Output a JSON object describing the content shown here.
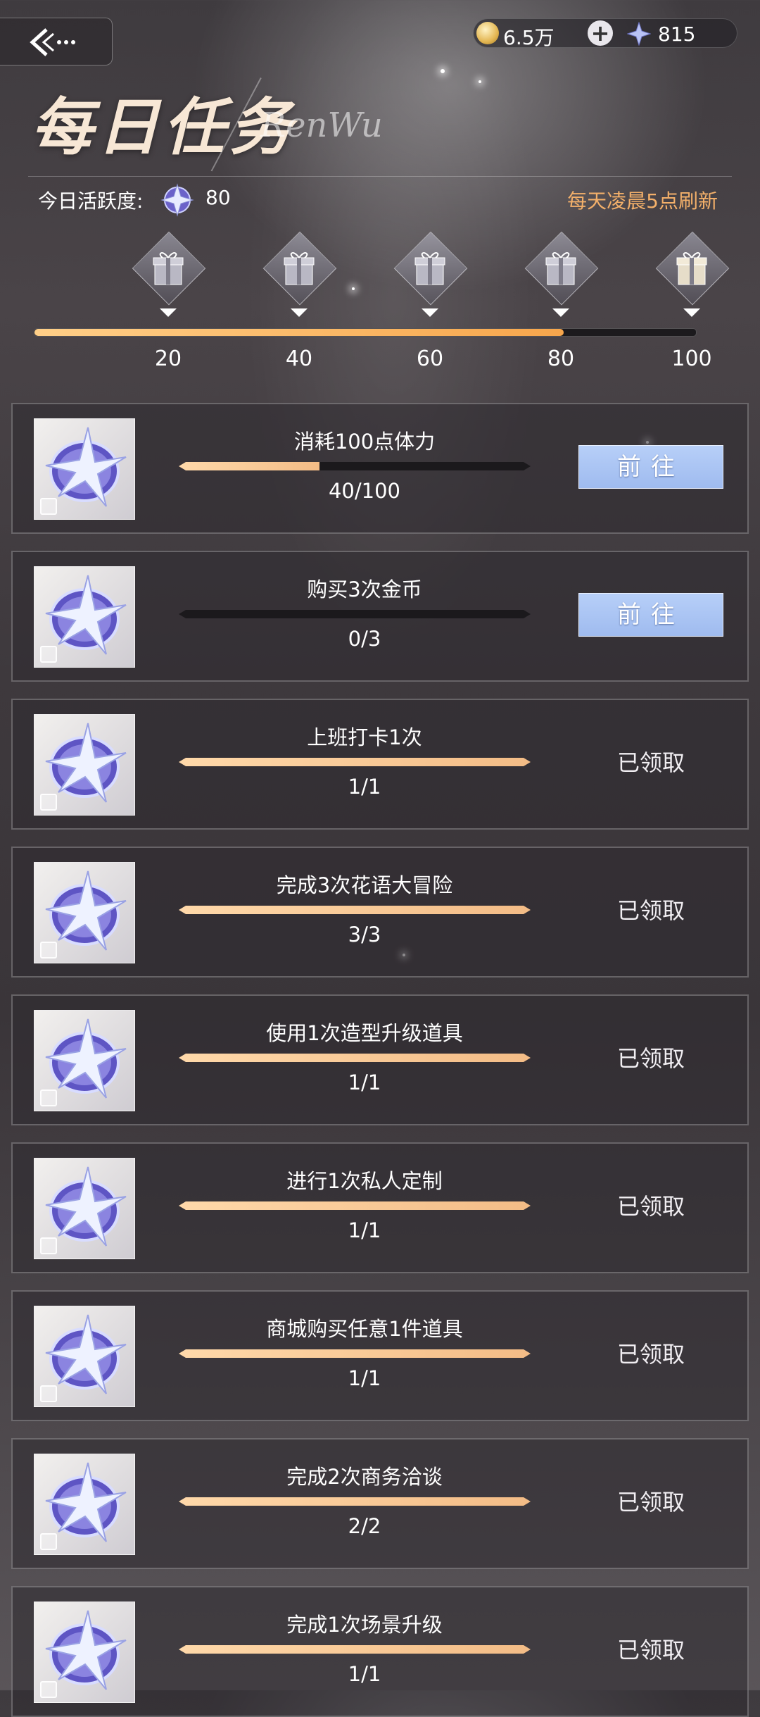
{
  "header": {
    "title": "每日任务",
    "title_deco": "RenWu",
    "coins": "6.5万",
    "gems": "815"
  },
  "activity": {
    "label": "今日活跃度:",
    "value": "80",
    "refresh_note": "每天凌晨5点刷新",
    "progress_fraction": 0.8,
    "milestones": [
      "20",
      "40",
      "60",
      "80",
      "100"
    ]
  },
  "tasks": [
    {
      "name": "消耗100点体力",
      "progress": "40/100",
      "fraction": 0.4,
      "action": "前往",
      "claimed": false
    },
    {
      "name": "购买3次金币",
      "progress": "0/3",
      "fraction": 0,
      "action": "前往",
      "claimed": false
    },
    {
      "name": "上班打卡1次",
      "progress": "1/1",
      "fraction": 1,
      "action": "已领取",
      "claimed": true
    },
    {
      "name": "完成3次花语大冒险",
      "progress": "3/3",
      "fraction": 1,
      "action": "已领取",
      "claimed": true
    },
    {
      "name": "使用1次造型升级道具",
      "progress": "1/1",
      "fraction": 1,
      "action": "已领取",
      "claimed": true
    },
    {
      "name": "进行1次私人定制",
      "progress": "1/1",
      "fraction": 1,
      "action": "已领取",
      "claimed": true
    },
    {
      "name": "商城购买任意1件道具",
      "progress": "1/1",
      "fraction": 1,
      "action": "已领取",
      "claimed": true
    },
    {
      "name": "完成2次商务洽谈",
      "progress": "2/2",
      "fraction": 1,
      "action": "已领取",
      "claimed": true
    },
    {
      "name": "完成1次场景升级",
      "progress": "1/1",
      "fraction": 1,
      "action": "已领取",
      "claimed": true
    }
  ],
  "colors": {
    "accent_orange": "#f3b06a",
    "button_blue": "#a9c4f3",
    "progress_fill": "#f7a64c"
  }
}
